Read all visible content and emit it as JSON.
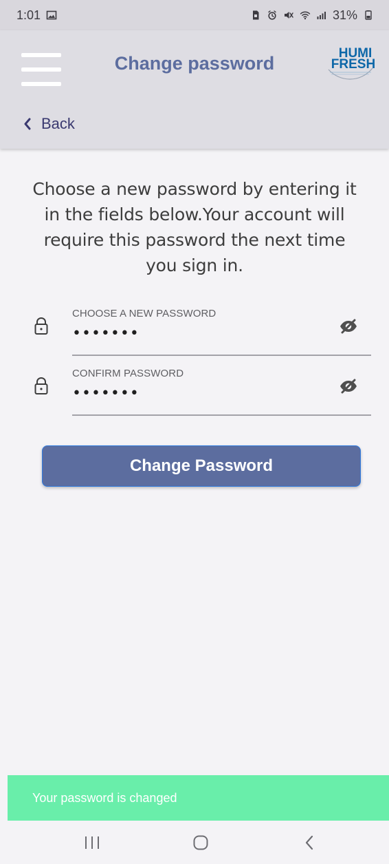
{
  "status_bar": {
    "time": "1:01",
    "battery_percent": "31%"
  },
  "header": {
    "title": "Change password",
    "logo_top": "HUMI",
    "logo_bottom": "FRESH",
    "back_label": "Back"
  },
  "main": {
    "intro_text": "Choose a new password by entering it in the fields below.Your account will require this password the next time you sign in.",
    "fields": [
      {
        "label": "CHOOSE A NEW PASSWORD",
        "value": "•••••••"
      },
      {
        "label": "CONFIRM PASSWORD",
        "value": "•••••••"
      }
    ],
    "submit_label": "Change Password"
  },
  "toast": {
    "message": "Your password is changed"
  },
  "colors": {
    "brand": "#5c6d9f",
    "app_bar": "#dedde3",
    "background": "#f4f3f6",
    "toast": "#69eeaa"
  },
  "icons": {
    "menu": "hamburger-icon",
    "back": "chevron-left-icon",
    "lock": "lock-icon",
    "visibility": "eye-off-icon",
    "nav_recent": "recent-apps-icon",
    "nav_home": "home-icon",
    "nav_back": "back-icon"
  }
}
